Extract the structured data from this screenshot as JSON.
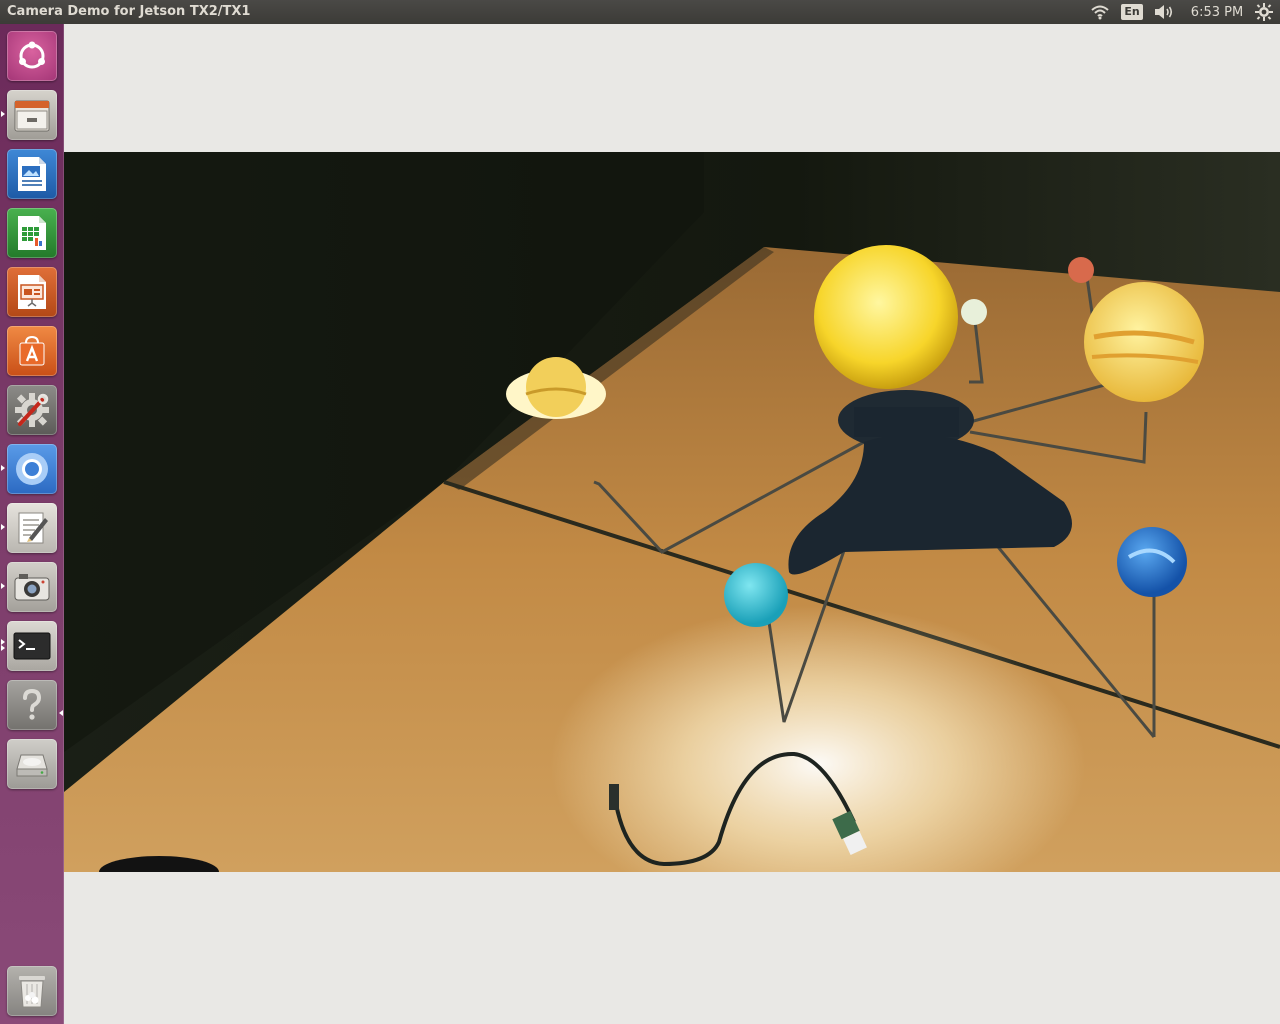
{
  "window": {
    "title": "Camera Demo for Jetson TX2/TX1"
  },
  "indicators": {
    "language": "En",
    "clock": "6:53 PM"
  },
  "launcher": {
    "items": [
      {
        "name": "ubuntu-dash",
        "icon": "ubuntu-logo-icon",
        "color": "#c24c8f"
      },
      {
        "name": "files",
        "icon": "file-cabinet-icon",
        "color": "#b6b2ab"
      },
      {
        "name": "writer",
        "icon": "document-writer-icon",
        "color": "#2a6fc1"
      },
      {
        "name": "calc",
        "icon": "spreadsheet-calc-icon",
        "color": "#2f9b3a"
      },
      {
        "name": "impress",
        "icon": "presentation-impress-icon",
        "color": "#c9551f"
      },
      {
        "name": "software-center",
        "icon": "shopping-bag-icon",
        "color": "#e2672a"
      },
      {
        "name": "system-settings",
        "icon": "settings-tools-icon",
        "color": "#7b7b7b"
      },
      {
        "name": "chromium",
        "icon": "chromium-browser-icon",
        "color": "#4a86d6"
      },
      {
        "name": "text-editor",
        "icon": "text-editor-icon",
        "color": "#d9d6cf"
      },
      {
        "name": "camera-app",
        "icon": "camera-icon",
        "color": "#bdbab3"
      },
      {
        "name": "terminal",
        "icon": "terminal-icon",
        "color": "#3a3a3a"
      },
      {
        "name": "help",
        "icon": "help-question-icon",
        "color": "#8d8d8d"
      },
      {
        "name": "disk",
        "icon": "disk-drive-icon",
        "color": "#c8c6c1"
      },
      {
        "name": "trash",
        "icon": "trash-icon",
        "color": "#9a9894"
      }
    ]
  }
}
